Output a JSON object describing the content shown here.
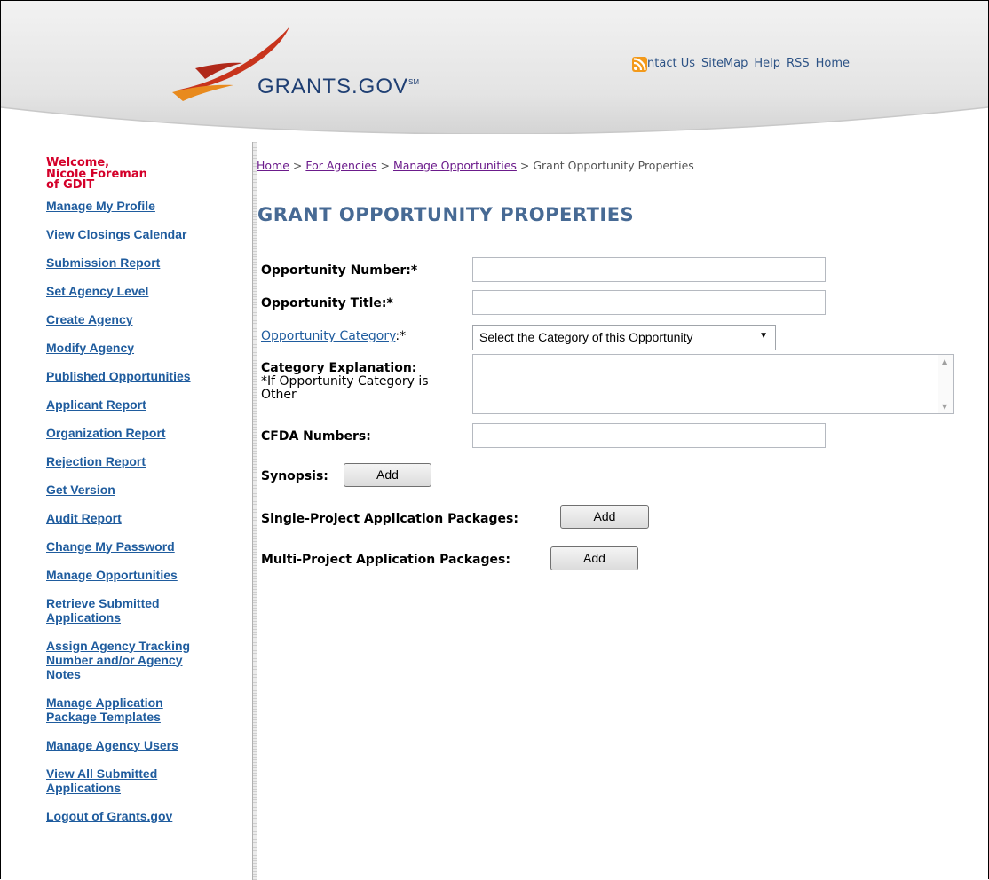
{
  "header": {
    "logo_text": "GRANTS.GOV",
    "logo_mark": "SM",
    "links": {
      "contact": "Contact Us",
      "sitemap": "SiteMap",
      "help": "Help",
      "rss": "RSS",
      "home": "Home"
    },
    "colors": {
      "logo": "#1f3f73",
      "swoosh_red": "#c8341c",
      "swoosh_orange": "#e88a1d"
    }
  },
  "sidebar": {
    "welcome_line1": "Welcome,",
    "welcome_line2": "Nicole Foreman",
    "welcome_line3": "of GDIT",
    "items": [
      "Manage My Profile",
      "View Closings Calendar",
      "Submission Report",
      "Set Agency Level",
      "Create Agency",
      "Modify Agency",
      "Published Opportunities",
      "Applicant Report",
      "Organization Report",
      "Rejection Report",
      "Get Version",
      "Audit Report",
      "Change My Password",
      "Manage Opportunities",
      "Retrieve Submitted Applications",
      "Assign Agency Tracking Number and/or Agency Notes",
      "Manage Application Package Templates",
      "Manage Agency Users",
      "View All Submitted Applications",
      "Logout of Grants.gov"
    ]
  },
  "breadcrumb": {
    "home": "Home",
    "sep": ">",
    "agencies": "For Agencies",
    "manage": "Manage Opportunities",
    "current": "Grant Opportunity Properties"
  },
  "main": {
    "title": "GRANT OPPORTUNITY PROPERTIES",
    "labels": {
      "opp_number": "Opportunity Number:*",
      "opp_title": "Opportunity Title:*",
      "opp_category": "Opportunity Category",
      "opp_category_suffix": ":*",
      "category_explanation": "Category Explanation:",
      "category_note_1": "*If Opportunity Category is",
      "category_note_2": "Other",
      "cfda": "CFDA Numbers:",
      "synopsis": "Synopsis:",
      "single_pkg": "Single-Project Application Packages:",
      "multi_pkg": "Multi-Project Application Packages:"
    },
    "inputs": {
      "opp_number_value": "",
      "opp_title_value": "",
      "cfda_value": "",
      "category_explanation_value": ""
    },
    "category_select": "Select the Category of this Opportunity",
    "add_label": "Add"
  }
}
